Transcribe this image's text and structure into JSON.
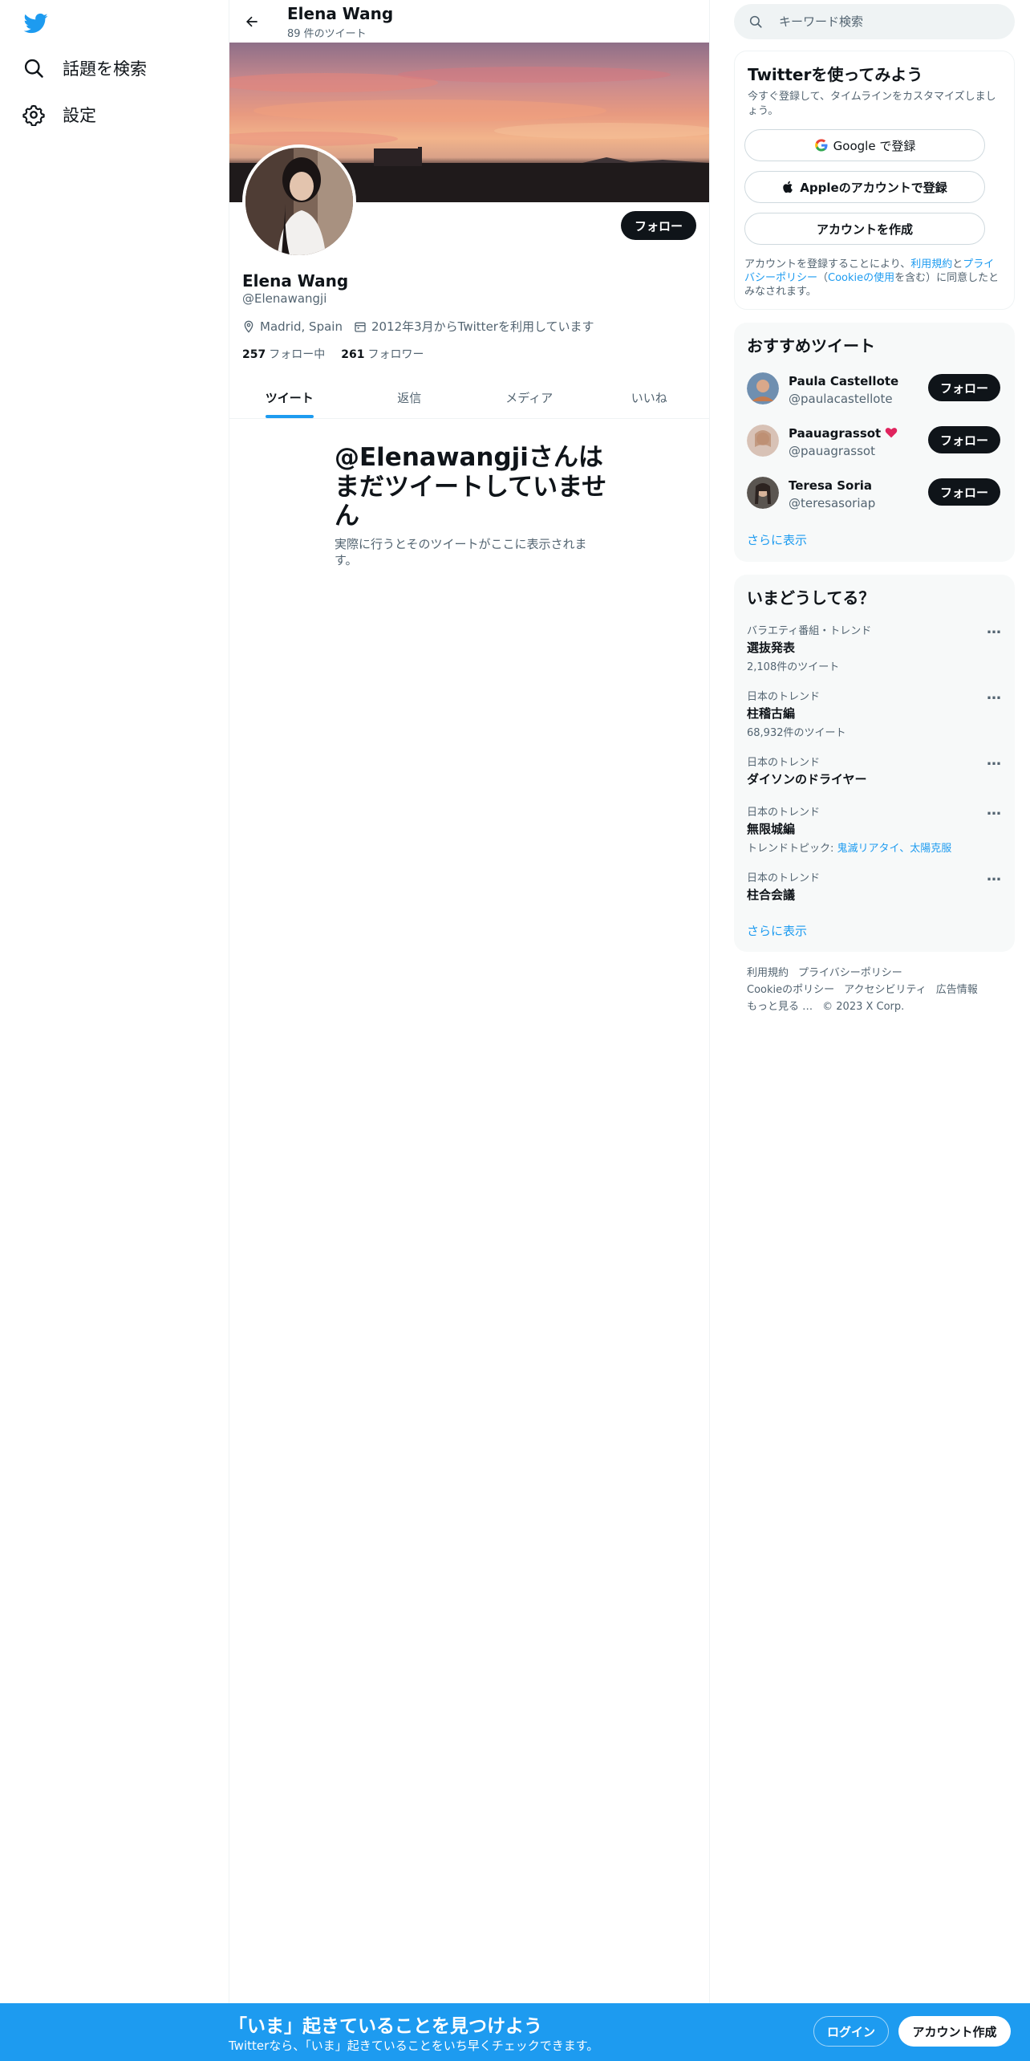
{
  "nav": {
    "explore_label": "話題を検索",
    "settings_label": "設定"
  },
  "header": {
    "name": "Elena Wang",
    "tweet_count": "89 件のツイート"
  },
  "profile": {
    "name": "Elena Wang",
    "handle": "@Elenawangji",
    "location": "Madrid, Spain",
    "joined": "2012年3月からTwitterを利用しています",
    "following_count": "257",
    "following_label": "フォロー中",
    "followers_count": "261",
    "followers_label": "フォロワー",
    "follow_button": "フォロー"
  },
  "tabs": [
    "ツイート",
    "返信",
    "メディア",
    "いいね"
  ],
  "empty_state": {
    "title": "@Elenawangjiさんはまだツイートしていません",
    "subtitle": "実際に行うとそのツイートがここに表示されます。"
  },
  "search": {
    "placeholder": "キーワード検索"
  },
  "signup": {
    "title": "Twitterを使ってみよう",
    "subtitle": "今すぐ登録して、タイムラインをカスタマイズしましょう。",
    "google_button": "Google で登録",
    "apple_button": "Appleのアカウントで登録",
    "create_button": "アカウントを作成",
    "legal_prefix": "アカウントを登録することにより、",
    "legal_terms": "利用規約",
    "legal_and": "と",
    "legal_privacy": "プライバシーポリシー",
    "legal_paren_open": "（",
    "legal_cookie": "Cookieの使用",
    "legal_suffix": "を含む）に同意したとみなされます。"
  },
  "recommended": {
    "title": "おすすめツイート",
    "users": [
      {
        "name": "Paula Castellote",
        "handle": "@paulacastellote",
        "button": "フォロー"
      },
      {
        "name": "Paauagrassot",
        "handle": "@pauagrassot",
        "button": "フォロー"
      },
      {
        "name": "Teresa Soria",
        "handle": "@teresasoriap",
        "button": "フォロー"
      }
    ],
    "show_more": "さらに表示"
  },
  "trends": {
    "title": "いまどうしてる？",
    "items": [
      {
        "context": "バラエティ番組・トレンド",
        "topic": "選抜発表",
        "count": "2,108件のツイート"
      },
      {
        "context": "日本のトレンド",
        "topic": "柱稽古編",
        "count": "68,932件のツイート"
      },
      {
        "context": "日本のトレンド",
        "topic": "ダイソンのドライヤー",
        "count": ""
      },
      {
        "context": "日本のトレンド",
        "topic": "無限城編",
        "count_prefix": "トレンドトピック: ",
        "count_links": "鬼滅リアタイ、太陽克服"
      },
      {
        "context": "日本のトレンド",
        "topic": "柱合会議",
        "count": ""
      }
    ],
    "more_icon": "…",
    "show_more": "さらに表示"
  },
  "footer": {
    "links": [
      "利用規約",
      "プライバシーポリシー",
      "Cookieのポリシー",
      "アクセシビリティ",
      "広告情報",
      "もっと見る …",
      "© 2023 X Corp."
    ]
  },
  "bottom_bar": {
    "title": "「いま」起きていることを見つけよう",
    "subtitle": "Twitterなら、「いま」起きていることをいち早くチェックできます。",
    "login": "ログイン",
    "signup": "アカウント作成"
  },
  "colors": {
    "accent": "#1d9bf0",
    "text": "#0f1419",
    "secondary": "#536471",
    "panel": "#f7f9f9"
  },
  "icons": [
    "twitter-logo-icon",
    "search-icon",
    "gear-icon",
    "back-arrow-icon",
    "location-icon",
    "calendar-icon",
    "google-icon",
    "apple-icon",
    "red-heart-emoji-icon",
    "more-icon"
  ]
}
